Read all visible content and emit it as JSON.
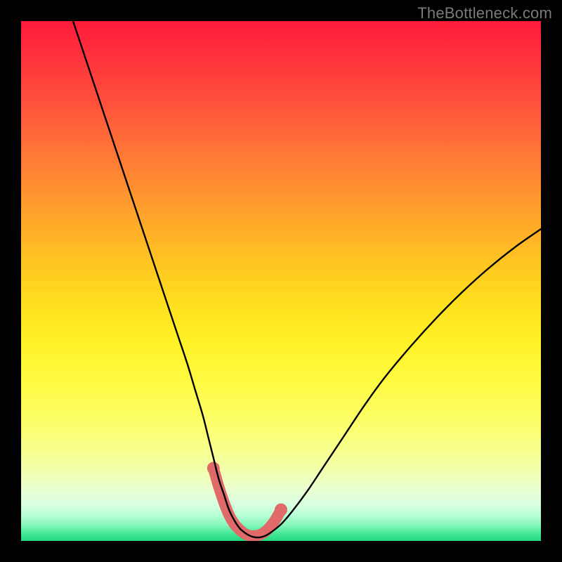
{
  "watermark": "TheBottleneck.com",
  "chart_data": {
    "type": "line",
    "title": "",
    "xlabel": "",
    "ylabel": "",
    "xlim": [
      0,
      100
    ],
    "ylim": [
      0,
      100
    ],
    "series": [
      {
        "name": "bottleneck-curve",
        "color": "#000000",
        "x": [
          10,
          12,
          14,
          16,
          18,
          20,
          22,
          24,
          26,
          28,
          30,
          32,
          33.5,
          35,
          36,
          37,
          38,
          39,
          40,
          41,
          42,
          43,
          44,
          45,
          46,
          47,
          48,
          50,
          52,
          55,
          58,
          62,
          66,
          70,
          75,
          80,
          85,
          90,
          95,
          100
        ],
        "y": [
          100,
          94,
          88,
          82,
          76,
          70,
          64,
          58,
          52,
          46,
          40,
          34,
          29,
          24,
          20,
          16,
          12,
          9,
          6,
          4,
          2.5,
          1.6,
          1.0,
          0.7,
          0.7,
          1.0,
          1.6,
          3.2,
          5.5,
          9.5,
          14,
          20,
          26,
          31.5,
          37.5,
          43,
          48,
          52.5,
          56.5,
          60
        ]
      },
      {
        "name": "highlight-band",
        "color": "#e06a6a",
        "x": [
          37,
          38,
          39,
          40,
          41,
          42,
          43,
          44,
          45,
          46,
          47,
          48,
          49,
          50
        ],
        "y": [
          14,
          10.5,
          7.5,
          5,
          3.3,
          2.2,
          1.4,
          1.0,
          1.0,
          1.2,
          1.8,
          2.8,
          4.2,
          6.0
        ]
      }
    ],
    "gradient_colors": {
      "top": "#ff1a3a",
      "mid_upper": "#ff8833",
      "mid": "#ffde1e",
      "mid_lower": "#f4ffa0",
      "bottom": "#1fd981"
    }
  }
}
